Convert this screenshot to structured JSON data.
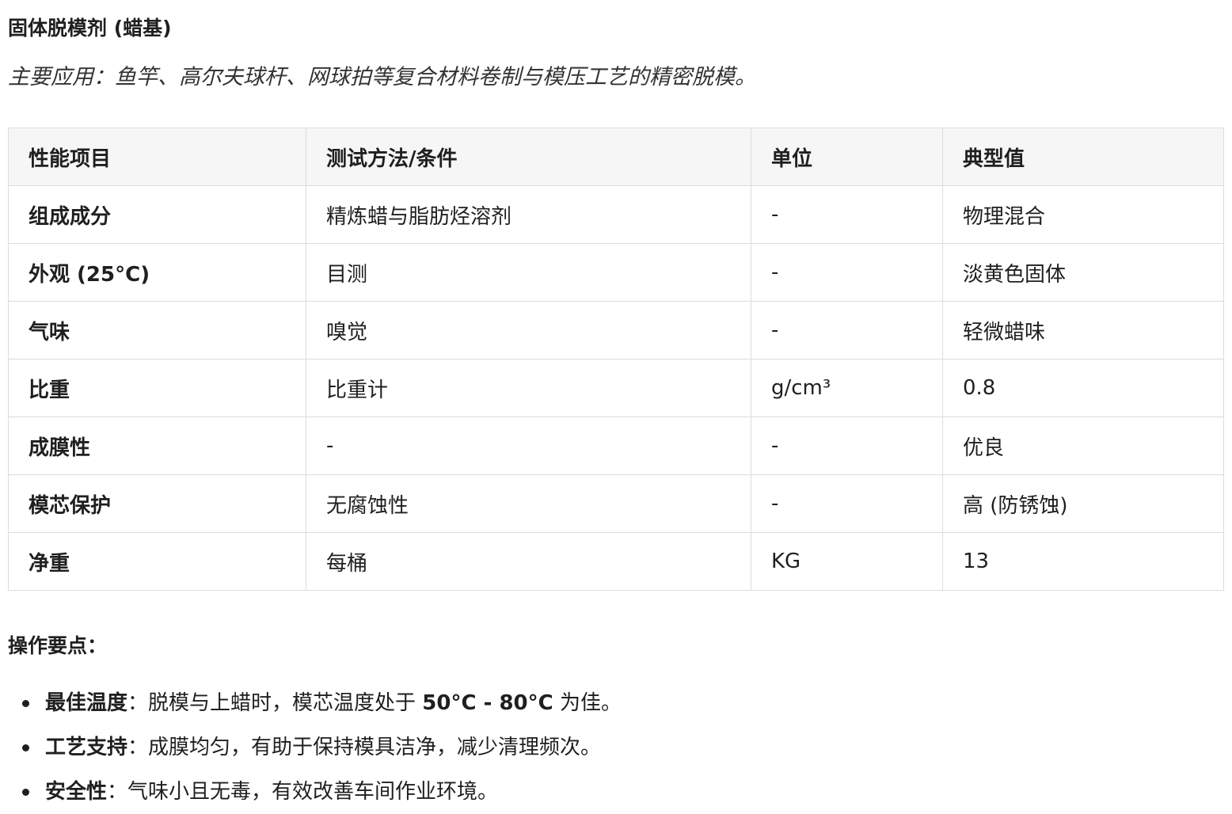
{
  "title": "固体脱模剂 (蜡基)",
  "subtitle": "主要应用：鱼竿、高尔夫球杆、网球拍等复合材料卷制与模压工艺的精密脱模。",
  "table": {
    "headers": [
      "性能项目",
      "测试方法/条件",
      "单位",
      "典型值"
    ],
    "rows": [
      [
        "组成成分",
        "精炼蜡与脂肪烃溶剂",
        "-",
        "物理混合"
      ],
      [
        "外观 (25°C)",
        "目测",
        "-",
        "淡黄色固体"
      ],
      [
        "气味",
        "嗅觉",
        "-",
        "轻微蜡味"
      ],
      [
        "比重",
        "比重计",
        "g/cm³",
        "0.8"
      ],
      [
        "成膜性",
        "-",
        "-",
        "优良"
      ],
      [
        "模芯保护",
        "无腐蚀性",
        "-",
        "高 (防锈蚀)"
      ],
      [
        "净重",
        "每桶",
        "KG",
        "13"
      ]
    ]
  },
  "operations": {
    "heading": "操作要点：",
    "items": [
      {
        "label": "最佳温度",
        "pre": "：脱模与上蜡时，模芯温度处于 ",
        "highlight": "50°C - 80°C",
        "post": " 为佳。"
      },
      {
        "label": "工艺支持",
        "pre": "：成膜均匀，有助于保持模具洁净，减少清理频次。",
        "highlight": "",
        "post": ""
      },
      {
        "label": "安全性",
        "pre": "：气味小且无毒，有效改善车间作业环境。",
        "highlight": "",
        "post": ""
      }
    ]
  }
}
